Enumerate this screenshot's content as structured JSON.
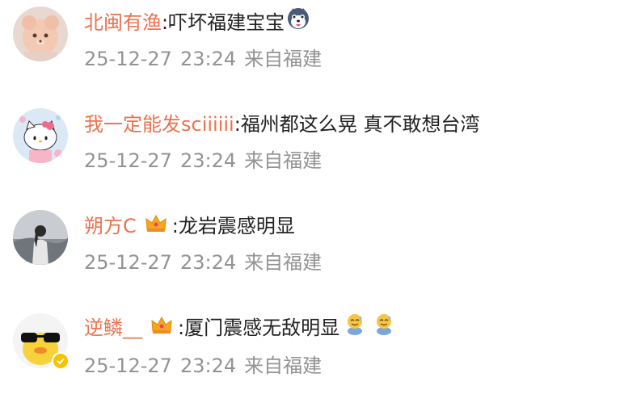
{
  "comments": [
    {
      "username": "北闽有渔",
      "separator": ":",
      "text": "吓坏福建宝宝",
      "emoji": "husky-dog-emoji",
      "date": "25-12-27",
      "time": "23:24",
      "location": "来自福建",
      "avatar": "pink-bear-avatar"
    },
    {
      "username": "我一定能发sciiiiii",
      "separator": ":",
      "text": "福州都这么晃 真不敢想台湾",
      "date": "25-12-27",
      "time": "23:24",
      "location": "来自福建",
      "avatar": "hello-kitty-avatar"
    },
    {
      "username": "朔方C",
      "separator": ":",
      "text": "龙岩震感明显",
      "badge": "crown-icon",
      "date": "25-12-27",
      "time": "23:24",
      "location": "来自福建",
      "avatar": "person-landscape-avatar"
    },
    {
      "username": "逆鳞__",
      "separator": ":",
      "text": "厦门震感无敌明显",
      "badge": "crown-icon",
      "emoji": "sweat-face-emoji",
      "date": "25-12-27",
      "time": "23:24",
      "location": "来自福建",
      "avatar": "sunglasses-duck-avatar",
      "verified": "verified-badge-icon"
    }
  ],
  "colors": {
    "username": "#eb7350",
    "text": "#222222",
    "meta": "#939393",
    "crown": "#f5a623"
  }
}
